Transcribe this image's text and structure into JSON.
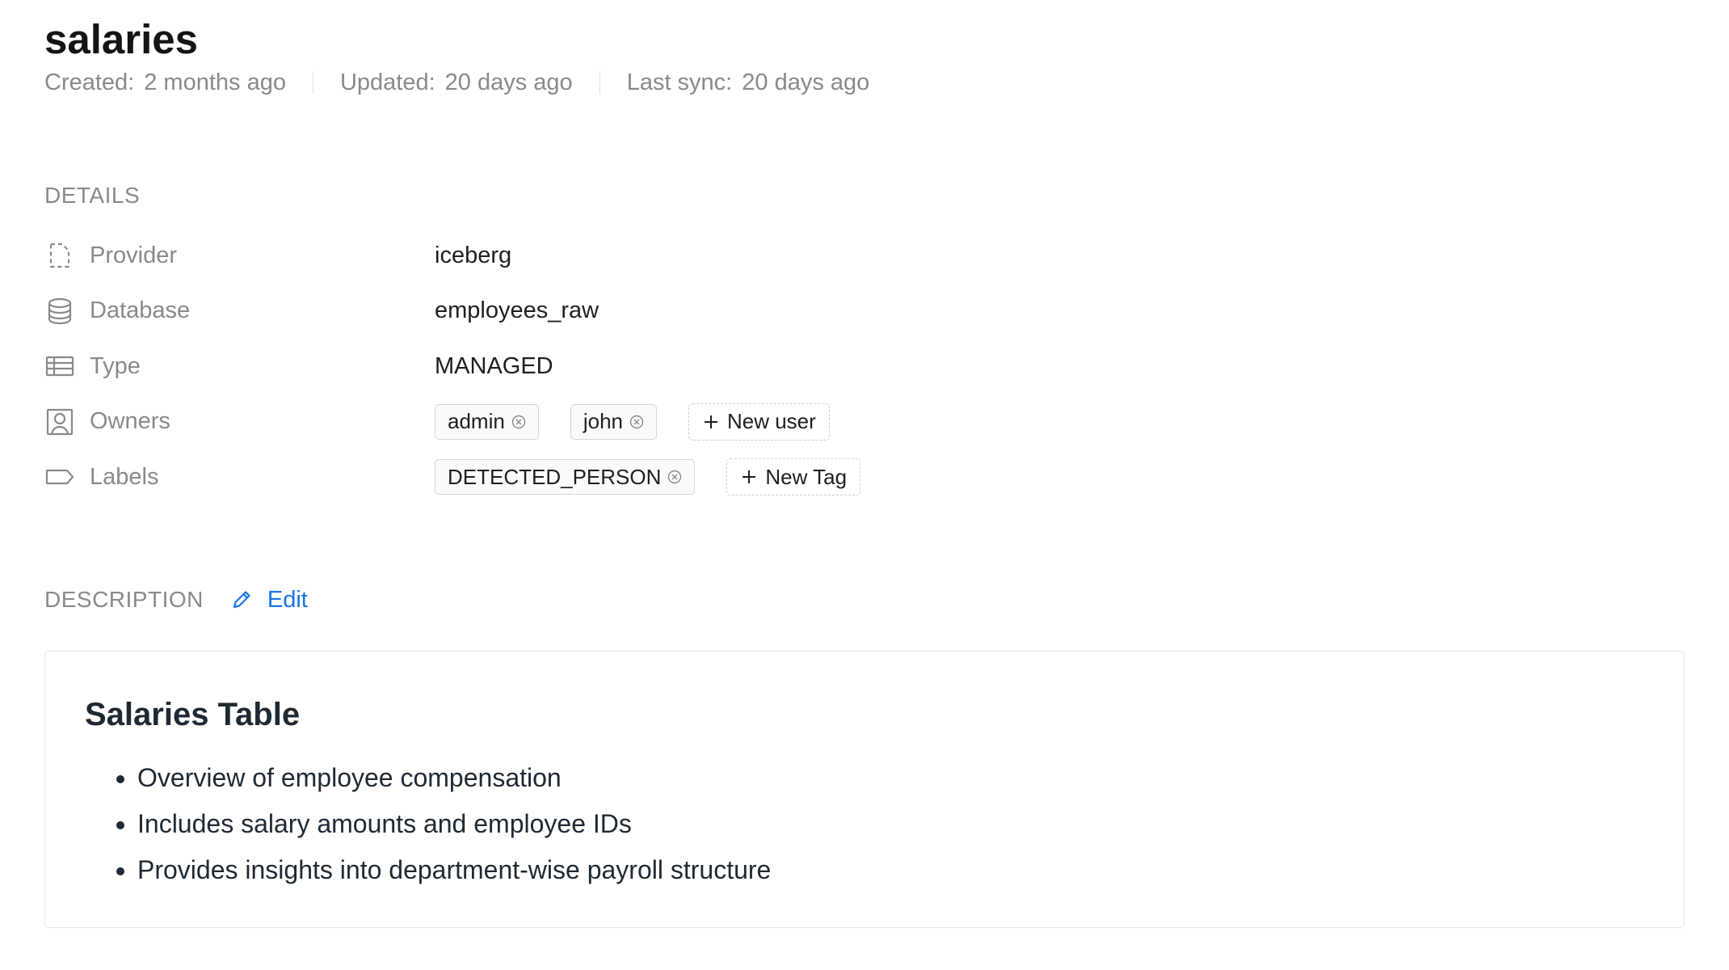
{
  "header": {
    "title": "salaries",
    "meta": [
      {
        "label": "Created:",
        "value": "2 months ago"
      },
      {
        "label": "Updated:",
        "value": "20 days ago"
      },
      {
        "label": "Last sync:",
        "value": "20 days ago"
      }
    ]
  },
  "details": {
    "heading": "DETAILS",
    "rows": [
      {
        "label": "Provider",
        "icon": "provider-icon",
        "value": "iceberg"
      },
      {
        "label": "Database",
        "icon": "database-icon",
        "value": "employees_raw"
      },
      {
        "label": "Type",
        "icon": "table-icon",
        "value": "MANAGED"
      },
      {
        "label": "Owners",
        "icon": "user-icon",
        "chips": [
          "admin",
          "john"
        ],
        "add_label": "New user"
      },
      {
        "label": "Labels",
        "icon": "tag-icon",
        "chips": [
          "DETECTED_PERSON"
        ],
        "add_label": "New Tag"
      }
    ]
  },
  "description": {
    "heading": "DESCRIPTION",
    "edit_label": "Edit",
    "title": "Salaries Table",
    "bullets": [
      "Overview of employee compensation",
      "Includes salary amounts and employee IDs",
      "Provides insights into department-wise payroll structure"
    ]
  },
  "colors": {
    "accent": "#1a73e8",
    "muted_text": "#8a8a8a",
    "text": "#1f1f1f"
  }
}
